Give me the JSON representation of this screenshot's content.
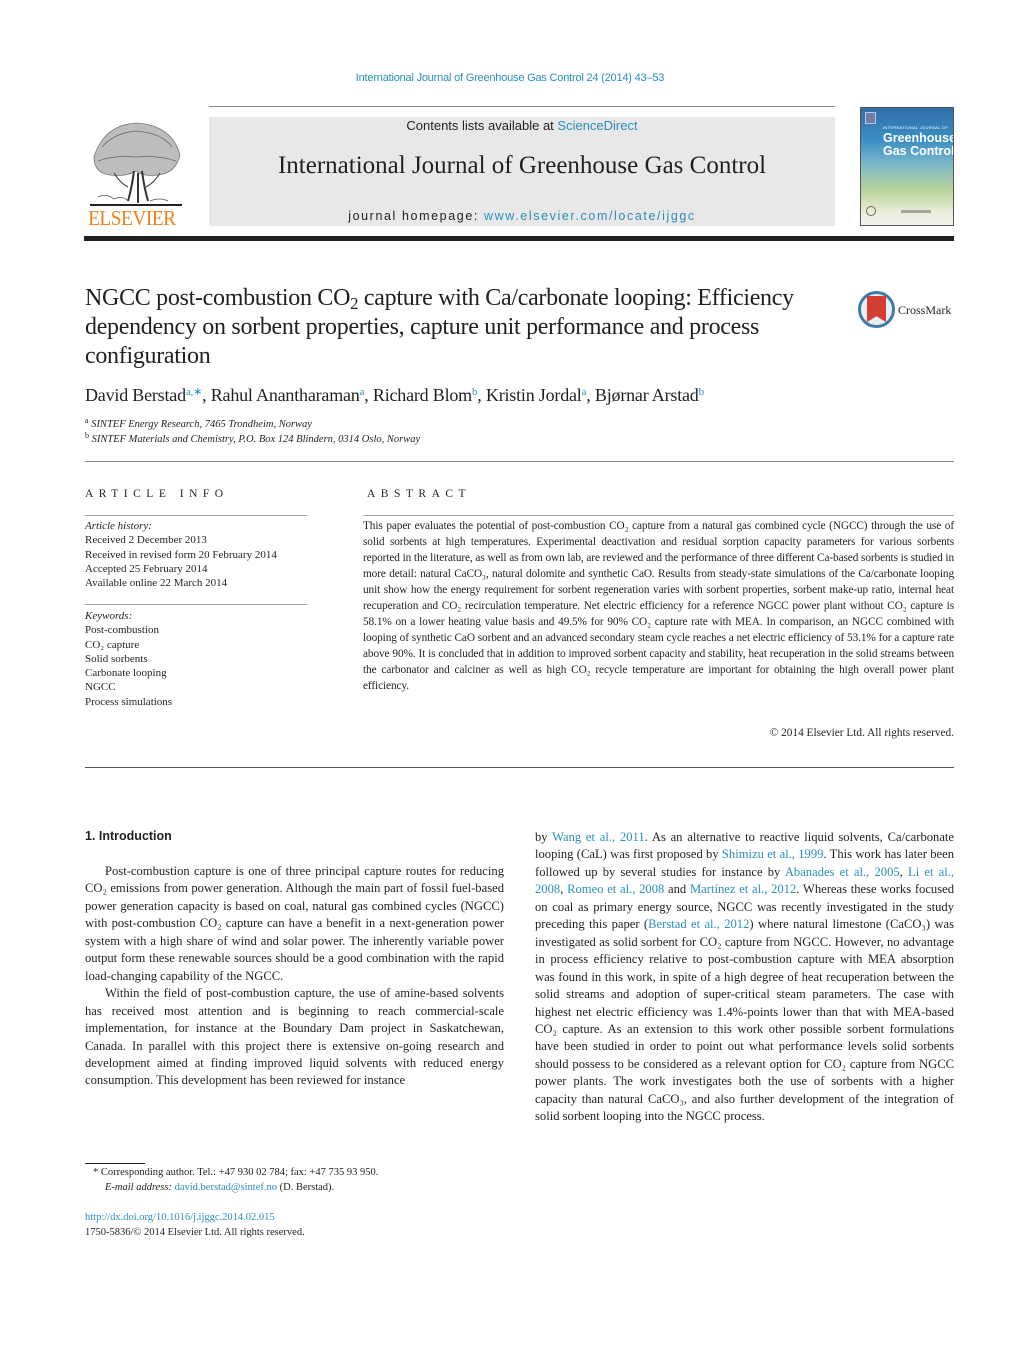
{
  "running_head": "International Journal of Greenhouse Gas Control 24 (2014) 43–53",
  "masthead": {
    "publisher_logo_text": "ELSEVIER",
    "contents_prefix": "Contents lists available at ",
    "contents_link": "ScienceDirect",
    "journal_title": "International Journal of Greenhouse Gas Control",
    "homepage_prefix": "journal homepage: ",
    "homepage_link": "www.elsevier.com/locate/ijggc",
    "cover": {
      "small_caption": "INTERNATIONAL JOURNAL OF",
      "title_line1": "Greenhouse",
      "title_line2": "Gas Control"
    }
  },
  "article": {
    "title_part1": "NGCC post-combustion CO",
    "title_sub": "2",
    "title_part2": " capture with Ca/carbonate looping: Efficiency dependency on sorbent properties, capture unit performance and process configuration",
    "crossmark_label": "CrossMark",
    "authors": [
      {
        "name": "David Berstad",
        "aff": "a,∗"
      },
      {
        "name": "Rahul Anantharaman",
        "aff": "a"
      },
      {
        "name": "Richard Blom",
        "aff": "b"
      },
      {
        "name": "Kristin Jordal",
        "aff": "a"
      },
      {
        "name": "Bjørnar Arstad",
        "aff": "b"
      }
    ],
    "affiliations": [
      {
        "key": "a",
        "text": "SINTEF Energy Research, 7465 Trondheim, Norway"
      },
      {
        "key": "b",
        "text": "SINTEF Materials and Chemistry, P.O. Box 124 Blindern, 0314 Oslo, Norway"
      }
    ]
  },
  "article_info": {
    "label": "ARTICLE INFO",
    "history_label": "Article history:",
    "history": [
      "Received 2 December 2013",
      "Received in revised form 20 February 2014",
      "Accepted 25 February 2014",
      "Available online 22 March 2014"
    ],
    "keywords_label": "Keywords:",
    "keywords": [
      "Post-combustion",
      "CO₂ capture",
      "Solid sorbents",
      "Carbonate looping",
      "NGCC",
      "Process simulations"
    ]
  },
  "abstract": {
    "label": "ABSTRACT",
    "text": "This paper evaluates the potential of post-combustion CO₂ capture from a natural gas combined cycle (NGCC) through the use of solid sorbents at high temperatures. Experimental deactivation and residual sorption capacity parameters for various sorbents reported in the literature, as well as from own lab, are reviewed and the performance of three different Ca-based sorbents is studied in more detail: natural CaCO₃, natural dolomite and synthetic CaO. Results from steady-state simulations of the Ca/carbonate looping unit show how the energy requirement for sorbent regeneration varies with sorbent properties, sorbent make-up ratio, internal heat recuperation and CO₂ recirculation temperature. Net electric efficiency for a reference NGCC power plant without CO₂ capture is 58.1% on a lower heating value basis and 49.5% for 90% CO₂ capture rate with MEA. In comparison, an NGCC combined with looping of synthetic CaO sorbent and an advanced secondary steam cycle reaches a net electric efficiency of 53.1% for a capture rate above 90%. It is concluded that in addition to improved sorbent capacity and stability, heat recuperation in the solid streams between the carbonator and calciner as well as high CO₂ recycle temperature are important for obtaining the high overall power plant efficiency.",
    "copyright": "© 2014 Elsevier Ltd. All rights reserved."
  },
  "body": {
    "section_heading": "1.  Introduction",
    "left_p1": "Post-combustion capture is one of three principal capture routes for reducing CO₂ emissions from power generation. Although the main part of fossil fuel-based power generation capacity is based on coal, natural gas combined cycles (NGCC) with post-combustion CO₂ capture can have a benefit in a next-generation power system with a high share of wind and solar power. The inherently variable power output form these renewable sources should be a good combination with the rapid load-changing capability of the NGCC.",
    "left_p2": "Within the field of post-combustion capture, the use of amine-based solvents has received most attention and is beginning to reach commercial-scale implementation, for instance at the Boundary Dam project in Saskatchewan, Canada. In parallel with this project there is extensive on-going research and development aimed at finding improved liquid solvents with reduced energy consumption. This development has been reviewed for instance",
    "right": {
      "t1": "by ",
      "c_wang": "Wang et al., 2011",
      "t2": ". As an alternative to reactive liquid solvents, Ca/carbonate looping (CaL) was first proposed by ",
      "c_shimizu": "Shimizu et al., 1999",
      "t3": ". This work has later been followed up by several studies for instance by ",
      "c_abanades": "Abanades et al., 2005",
      "t4": ", ",
      "c_li": "Li et al., 2008",
      "t5": ", ",
      "c_romeo": "Romeo et al., 2008",
      "t6": " and ",
      "c_martinez": "Martínez et al., 2012",
      "t7": ". Whereas these works focused on coal as primary energy source, NGCC was recently investigated in the study preceding this paper (",
      "c_berstad": "Berstad et al., 2012",
      "t8": ") where natural limestone (CaCO₃) was investigated as solid sorbent for CO₂ capture from NGCC. However, no advantage in process efficiency relative to post-combustion capture with MEA absorption was found in this work, in spite of a high degree of heat recuperation between the solid streams and adoption of super-critical steam parameters. The case with highest net electric efficiency was 1.4%-points lower than that with MEA-based CO₂ capture. As an extension to this work other possible sorbent formulations have been studied in order to point out what performance levels solid sorbents should possess to be considered as a relevant option for CO₂ capture from NGCC power plants. The work investigates both the use of sorbents with a higher capacity than natural CaCO₃, and also further development of the integration of solid sorbent looping into the NGCC process."
    }
  },
  "footnote": {
    "marker": "*",
    "line1": " Corresponding author. Tel.: +47 930 02 784; fax: +47 735 93 950.",
    "email_label": "E-mail address: ",
    "email": "david.berstad@sintef.no",
    "email_suffix": " (D. Berstad)."
  },
  "doi": {
    "link": "http://dx.doi.org/10.1016/j.ijggc.2014.02.015",
    "issn_line": "1750-5836/© 2014 Elsevier Ltd. All rights reserved."
  },
  "colors": {
    "link": "#2a8dbf",
    "elsevier_orange": "#f07f1a",
    "masthead_gray": "#e8e8e8",
    "crossmark_red": "#d33d33",
    "crossmark_blue": "#3c7aa8"
  }
}
